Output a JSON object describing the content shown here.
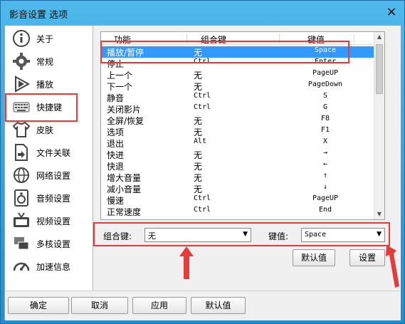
{
  "window": {
    "title": "影音设置 选项",
    "close_label": "×"
  },
  "sidebar": {
    "items": [
      {
        "label": "关于",
        "icon": "info-icon"
      },
      {
        "label": "常规",
        "icon": "gear-icon"
      },
      {
        "label": "播放",
        "icon": "play-icon"
      },
      {
        "label": "快捷键",
        "icon": "keyboard-icon"
      },
      {
        "label": "皮肤",
        "icon": "shirt-icon"
      },
      {
        "label": "文件关联",
        "icon": "file-icon"
      },
      {
        "label": "网络设置",
        "icon": "globe-icon"
      },
      {
        "label": "音频设置",
        "icon": "speaker-icon"
      },
      {
        "label": "视频设置",
        "icon": "tv-icon"
      },
      {
        "label": "多核设置",
        "icon": "multicore-icon"
      },
      {
        "label": "加速信息",
        "icon": "speedometer-icon"
      }
    ],
    "selected": "快捷键"
  },
  "hotkeys": {
    "headers": [
      "功能",
      "组合键",
      "键值"
    ],
    "rows": [
      {
        "func": "播放/暂停",
        "combo": "无",
        "key": "Space",
        "selected": true
      },
      {
        "func": "停止",
        "combo": "Ctrl",
        "key": "Enter"
      },
      {
        "func": "上一个",
        "combo": "无",
        "key": "PageUP"
      },
      {
        "func": "下一个",
        "combo": "无",
        "key": "PageDown"
      },
      {
        "func": "静音",
        "combo": "Ctrl",
        "key": "S"
      },
      {
        "func": "关闭影片",
        "combo": "Ctrl",
        "key": "G"
      },
      {
        "func": "全屏/恢复",
        "combo": "无",
        "key": "F8"
      },
      {
        "func": "选项",
        "combo": "无",
        "key": "F1"
      },
      {
        "func": "退出",
        "combo": "Alt",
        "key": "X"
      },
      {
        "func": "快进",
        "combo": "无",
        "key": "→"
      },
      {
        "func": "快退",
        "combo": "无",
        "key": "←"
      },
      {
        "func": "增大音量",
        "combo": "无",
        "key": "↑"
      },
      {
        "func": "减小音量",
        "combo": "无",
        "key": "↓"
      },
      {
        "func": "慢速",
        "combo": "Ctrl",
        "key": "PageUP"
      },
      {
        "func": "正常速度",
        "combo": "Ctrl",
        "key": "End"
      }
    ]
  },
  "editor": {
    "combo_label": "组合键:",
    "combo_value": "无",
    "key_label": "键值:",
    "key_value": "Space",
    "default_label": "默认值",
    "set_label": "设置"
  },
  "footer": {
    "ok": "确定",
    "cancel": "取消",
    "apply": "应用",
    "default": "默认值"
  },
  "colors": {
    "selection": "#3399ff",
    "highlight": "#e53b3b",
    "titlebar": "#2ea3e0"
  }
}
